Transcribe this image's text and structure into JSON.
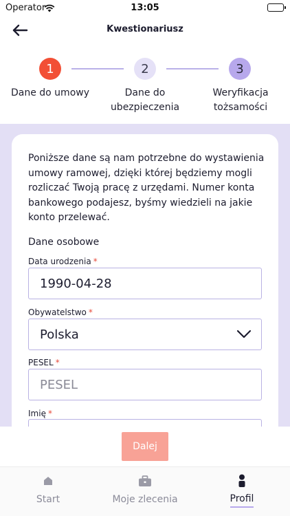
{
  "status_bar": {
    "carrier": "Operator",
    "time": "13:05"
  },
  "header": {
    "title": "Kwestionariusz"
  },
  "stepper": {
    "steps": [
      {
        "number": "1",
        "label_line1": "Dane do umowy",
        "label_line2": "",
        "state": "completed"
      },
      {
        "number": "2",
        "label_line1": "Dane do",
        "label_line2": "ubezpieczenia",
        "state": "upcoming"
      },
      {
        "number": "3",
        "label_line1": "Weryfikacja",
        "label_line2": "tożsamości",
        "state": "upcoming"
      }
    ]
  },
  "form": {
    "intro": "Poniższe dane są nam potrzebne do wystawienia umowy ramowej, dzięki której będziemy mogli rozliczać Twoją pracę z urzędami. Numer konta bankowego podajesz, byśmy wiedzieli na jakie konto przelewać.",
    "section_title": "Dane osobowe",
    "required_mark": "*",
    "fields": {
      "birth_date": {
        "label": "Data urodzenia",
        "value": "1990-04-28"
      },
      "citizenship": {
        "label": "Obywatelstwo",
        "value": "Polska"
      },
      "pesel": {
        "label": "PESEL",
        "placeholder": "PESEL",
        "value": ""
      },
      "first_name": {
        "label": "Imię"
      }
    }
  },
  "actions": {
    "next_label": "Dalej"
  },
  "tab_bar": {
    "tabs": [
      {
        "label": "Start",
        "icon": "home-icon"
      },
      {
        "label": "Moje zlecenia",
        "icon": "briefcase-icon"
      },
      {
        "label": "Profil",
        "icon": "profile-icon"
      }
    ],
    "active": "Profil"
  },
  "colors": {
    "accent": "#f24f35",
    "primary_disabled": "#f8a296",
    "lavender": "#b7a8ec",
    "lavender_light": "#e3dff5",
    "field_border": "#b8b1e3"
  }
}
